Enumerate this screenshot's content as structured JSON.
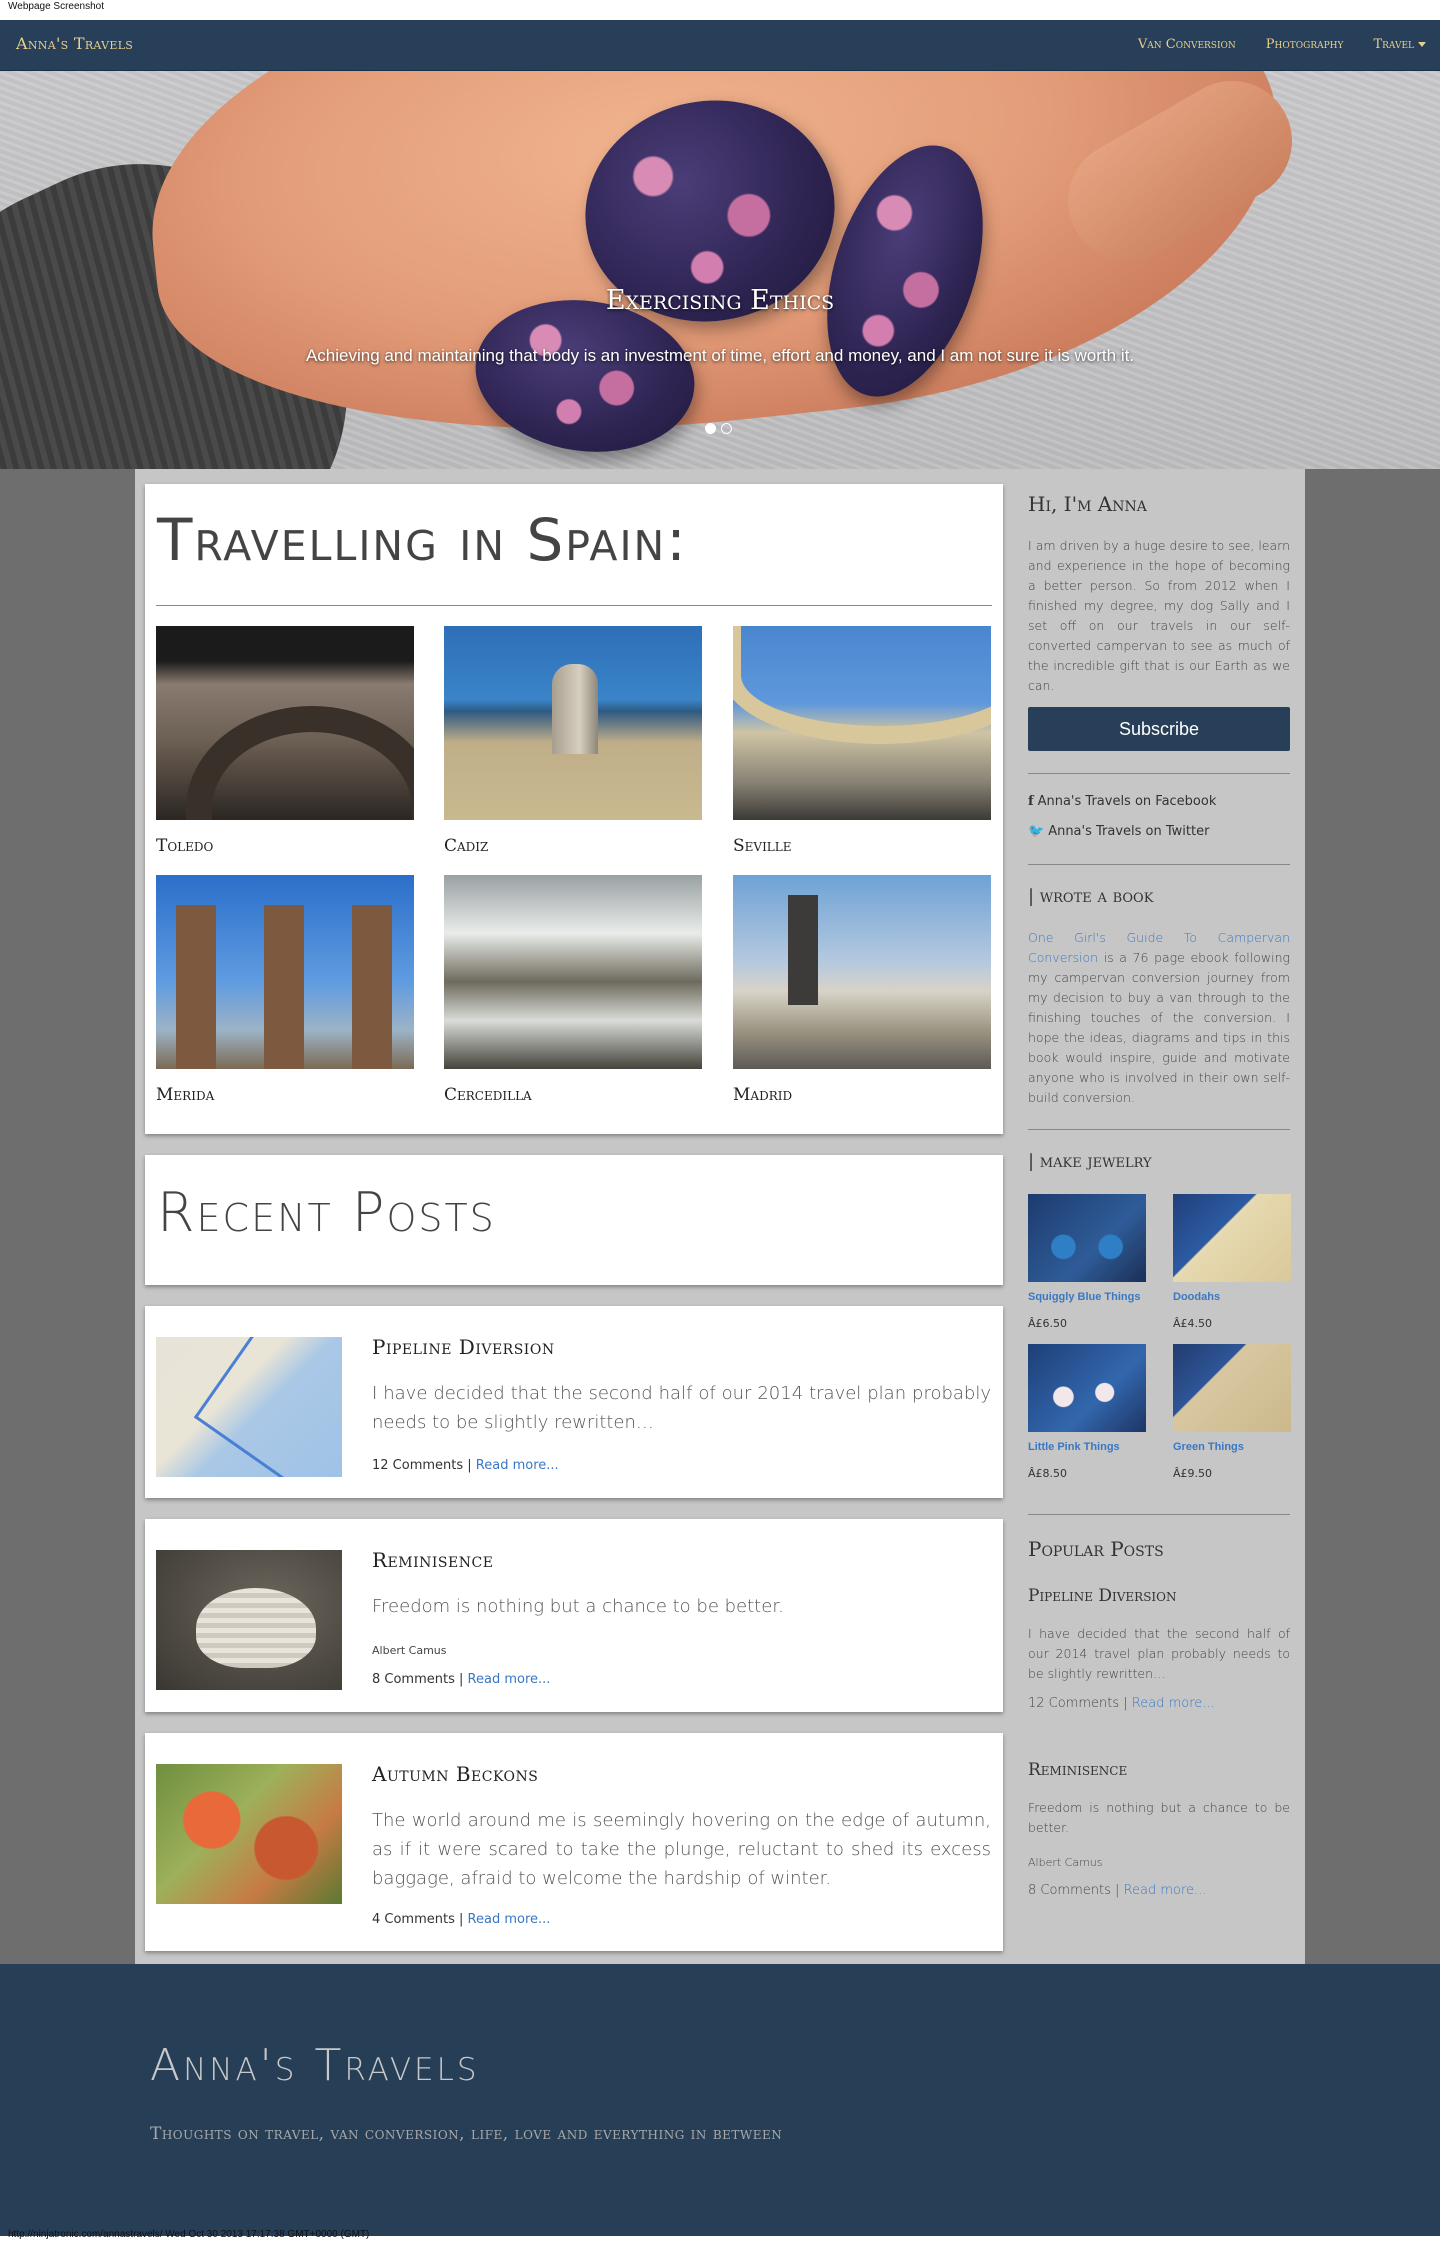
{
  "screenshot_label": "Webpage Screenshot",
  "navbar": {
    "brand": "Anna's Travels",
    "links": [
      "Van Conversion",
      "Photography",
      "Travel"
    ]
  },
  "hero": {
    "title": "Exercising Ethics",
    "text": "Achieving and maintaining that body is an investment of time, effort and money, and I am not sure it is worth it."
  },
  "spain": {
    "title": "Travelling in Spain:",
    "cities": [
      "Toledo",
      "Cadiz",
      "Seville",
      "Merida",
      "Cercedilla",
      "Madrid"
    ]
  },
  "recent": {
    "title": "Recent Posts",
    "posts": [
      {
        "title": "Pipeline Diversion",
        "excerpt": "I have decided that the second half of our 2014 travel plan probably needs to be slightly rewritten…",
        "comments": "12 Comments",
        "read_more": "Read more..."
      },
      {
        "title": "Reminisence",
        "excerpt": "Freedom is nothing but a chance to be better.",
        "author": "Albert Camus",
        "comments": "8 Comments",
        "read_more": "Read more..."
      },
      {
        "title": "Autumn Beckons",
        "excerpt": "The world around me is seemingly hovering on the edge of autumn, as if it were scared to take the plunge, reluctant to shed its excess baggage, afraid to welcome the hardship of winter.",
        "comments": "4 Comments",
        "read_more": "Read more..."
      }
    ]
  },
  "sidebar": {
    "intro_title": "Hi, I'm Anna",
    "intro_text": "I am driven by a huge desire to see, learn and experience in the hope of becoming a better person. So from 2012 when I finished my degree, my dog Sally and I set off on our travels in our self-converted campervan to see as much of the incredible gift that is our Earth as we can.",
    "subscribe": "Subscribe",
    "facebook": "Anna's Travels on Facebook",
    "twitter": "Anna's Travels on Twitter",
    "book_title": "| wrote a book",
    "book_link": "One Girl's Guide To Campervan Conversion",
    "book_text": " is a 76 page ebook following my campervan conversion journey from my decision to buy a van through to the finishing touches of the conversion. I hope the ideas, diagrams and tips in this book would inspire, guide and motivate anyone who is involved in their own self-build conversion.",
    "jewelry_title": "| make jewelry",
    "jewelry": [
      {
        "name": "Squiggly Blue Things",
        "price": "Â£6.50"
      },
      {
        "name": "Doodahs",
        "price": "Â£4.50"
      },
      {
        "name": "Little Pink Things",
        "price": "Â£8.50"
      },
      {
        "name": "Green Things",
        "price": "Â£9.50"
      }
    ],
    "popular_title": "Popular Posts",
    "popular": [
      {
        "title": "Pipeline Diversion",
        "excerpt": "I have decided that the second half of our 2014 travel plan probably needs to be slightly rewritten…",
        "comments": "12 Comments",
        "read_more": "Read more..."
      },
      {
        "title": "Reminisence",
        "excerpt": "Freedom is nothing but a chance to be better.",
        "author": "Albert Camus",
        "comments": "8 Comments",
        "read_more": "Read more..."
      }
    ]
  },
  "footer": {
    "title": "Anna's Travels",
    "tagline": "Thoughts on travel, van conversion, life, love and everything in between"
  },
  "status_bar": "http://ninjatronic.com/annastravels/ Wed Oct 30 2013 17:17:38 GMT+0000 (GMT)"
}
